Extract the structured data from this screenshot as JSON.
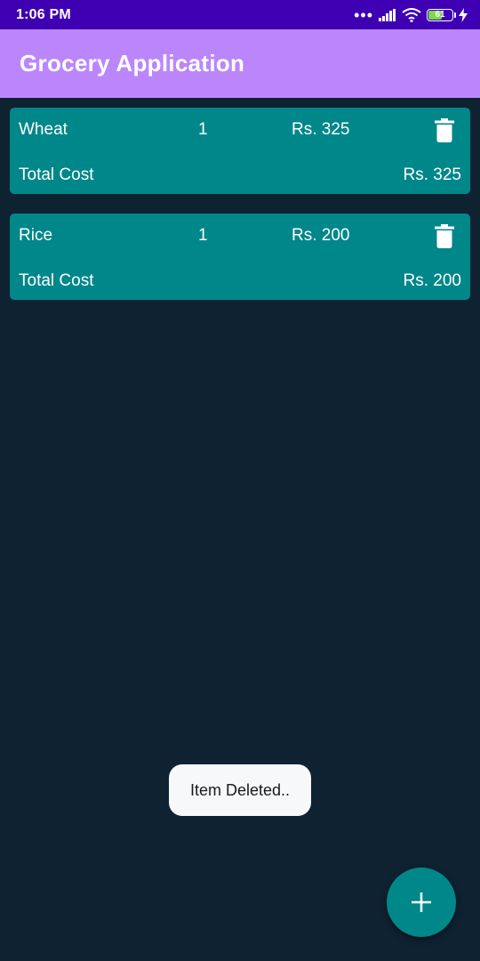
{
  "status_bar": {
    "time": "1:06 PM",
    "signal_dots": "•••",
    "battery_level": "61",
    "battery_fraction": 0.61,
    "icons": [
      "signal-icon",
      "wifi-icon",
      "battery-icon",
      "charging-icon"
    ]
  },
  "app_bar": {
    "title": "Grocery Application"
  },
  "items": [
    {
      "name": "Wheat",
      "quantity": "1",
      "price": "Rs. 325",
      "total_label": "Total Cost",
      "total_value": "Rs. 325",
      "delete_icon": "trash-icon"
    },
    {
      "name": "Rice",
      "quantity": "1",
      "price": "Rs. 200",
      "total_label": "Total Cost",
      "total_value": "Rs. 200",
      "delete_icon": "trash-icon"
    }
  ],
  "toast": {
    "message": "Item Deleted.."
  },
  "fab": {
    "icon": "plus-icon"
  },
  "colors": {
    "status_bar": "#3f00b3",
    "app_bar": "#bb86fc",
    "background": "#0f2232",
    "card": "#00878a",
    "toast": "#f7f8fa",
    "fab": "#00878a"
  }
}
